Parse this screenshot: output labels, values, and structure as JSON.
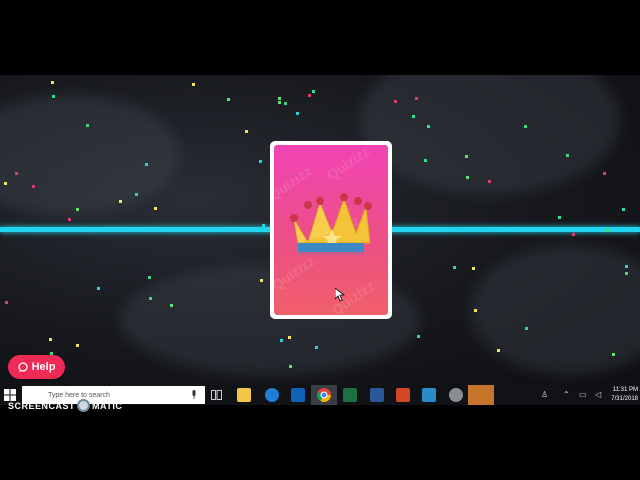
{
  "help_button": {
    "label": "Help"
  },
  "taskbar": {
    "search_placeholder": "Type here to search",
    "clock_time": "11:31 PM",
    "clock_date": "7/31/2018",
    "apps": [
      "file-explorer-icon",
      "edge-icon",
      "outlook-icon",
      "chrome-icon",
      "excel-icon",
      "word-icon",
      "powerpoint-icon",
      "app-icon",
      "mail-icon",
      "app-icon-2"
    ]
  },
  "card": {
    "watermark_text": "Quizizz"
  },
  "screencast": {
    "left": "SCREENCAST",
    "right": "MATIC"
  },
  "colors": {
    "beam": "#23d4f0",
    "card_top": "#f144b4",
    "card_bottom": "#f0606a",
    "help": "#ef2a55"
  }
}
